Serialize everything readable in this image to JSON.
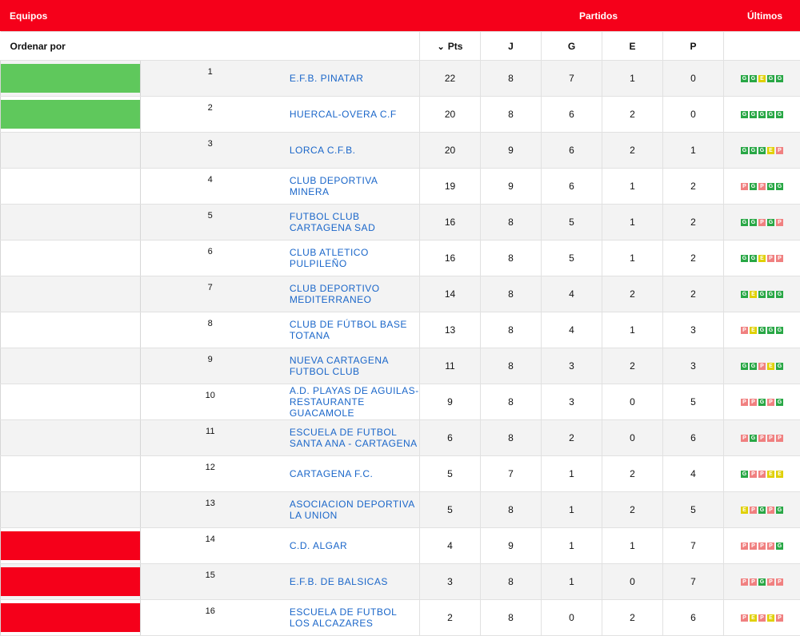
{
  "header": {
    "equipos": "Equipos",
    "partidos": "Partidos",
    "ultimos": "Últimos"
  },
  "columns": {
    "order_by": "Ordenar por",
    "pts": "Pts",
    "j": "J",
    "g": "G",
    "e": "E",
    "p": "P"
  },
  "colors": {
    "brand": "#f5001a",
    "link": "#1a66c9",
    "promo": "#5fc85c",
    "releg": "#f5001a",
    "G": "#28a745",
    "E": "#e0d000",
    "P": "#f08080"
  },
  "rows": [
    {
      "pos": "1",
      "team": "E.F.B. PINATAR",
      "pts": "22",
      "j": "8",
      "g": "7",
      "e": "1",
      "p": "0",
      "zone": "promo",
      "last": [
        "G",
        "G",
        "E",
        "G",
        "G"
      ]
    },
    {
      "pos": "2",
      "team": "HUERCAL-OVERA C.F",
      "pts": "20",
      "j": "8",
      "g": "6",
      "e": "2",
      "p": "0",
      "zone": "promo",
      "last": [
        "G",
        "G",
        "G",
        "G",
        "G"
      ]
    },
    {
      "pos": "3",
      "team": "LORCA C.F.B.",
      "pts": "20",
      "j": "9",
      "g": "6",
      "e": "2",
      "p": "1",
      "zone": "",
      "last": [
        "G",
        "G",
        "G",
        "E",
        "P"
      ]
    },
    {
      "pos": "4",
      "team": "CLUB DEPORTIVA MINERA",
      "pts": "19",
      "j": "9",
      "g": "6",
      "e": "1",
      "p": "2",
      "zone": "",
      "last": [
        "P",
        "G",
        "P",
        "G",
        "G"
      ]
    },
    {
      "pos": "5",
      "team": "FUTBOL CLUB CARTAGENA SAD",
      "pts": "16",
      "j": "8",
      "g": "5",
      "e": "1",
      "p": "2",
      "zone": "",
      "last": [
        "G",
        "G",
        "P",
        "G",
        "P"
      ]
    },
    {
      "pos": "6",
      "team": "CLUB ATLETICO PULPILEÑO",
      "pts": "16",
      "j": "8",
      "g": "5",
      "e": "1",
      "p": "2",
      "zone": "",
      "last": [
        "G",
        "G",
        "E",
        "P",
        "P"
      ]
    },
    {
      "pos": "7",
      "team": "CLUB DEPORTIVO MEDITERRANEO",
      "pts": "14",
      "j": "8",
      "g": "4",
      "e": "2",
      "p": "2",
      "zone": "",
      "last": [
        "G",
        "E",
        "G",
        "G",
        "G"
      ]
    },
    {
      "pos": "8",
      "team": "CLUB DE FÚTBOL BASE TOTANA",
      "pts": "13",
      "j": "8",
      "g": "4",
      "e": "1",
      "p": "3",
      "zone": "",
      "last": [
        "P",
        "E",
        "G",
        "G",
        "G"
      ]
    },
    {
      "pos": "9",
      "team": "NUEVA CARTAGENA FUTBOL CLUB",
      "pts": "11",
      "j": "8",
      "g": "3",
      "e": "2",
      "p": "3",
      "zone": "",
      "last": [
        "G",
        "G",
        "P",
        "E",
        "G"
      ]
    },
    {
      "pos": "10",
      "team": "A.D. PLAYAS DE AGUILAS-RESTAURANTE GUACAMOLE",
      "pts": "9",
      "j": "8",
      "g": "3",
      "e": "0",
      "p": "5",
      "zone": "",
      "last": [
        "P",
        "P",
        "G",
        "P",
        "G"
      ]
    },
    {
      "pos": "11",
      "team": "ESCUELA DE FUTBOL SANTA ANA - CARTAGENA",
      "pts": "6",
      "j": "8",
      "g": "2",
      "e": "0",
      "p": "6",
      "zone": "",
      "last": [
        "P",
        "G",
        "P",
        "P",
        "P"
      ]
    },
    {
      "pos": "12",
      "team": "CARTAGENA F.C.",
      "pts": "5",
      "j": "7",
      "g": "1",
      "e": "2",
      "p": "4",
      "zone": "",
      "last": [
        "G",
        "P",
        "P",
        "E",
        "E"
      ]
    },
    {
      "pos": "13",
      "team": "ASOCIACION DEPORTIVA LA UNION",
      "pts": "5",
      "j": "8",
      "g": "1",
      "e": "2",
      "p": "5",
      "zone": "",
      "last": [
        "E",
        "P",
        "G",
        "P",
        "G"
      ]
    },
    {
      "pos": "14",
      "team": "C.D. ALGAR",
      "pts": "4",
      "j": "9",
      "g": "1",
      "e": "1",
      "p": "7",
      "zone": "releg",
      "last": [
        "P",
        "P",
        "P",
        "P",
        "G"
      ]
    },
    {
      "pos": "15",
      "team": "E.F.B. DE BALSICAS",
      "pts": "3",
      "j": "8",
      "g": "1",
      "e": "0",
      "p": "7",
      "zone": "releg",
      "last": [
        "P",
        "P",
        "G",
        "P",
        "P"
      ]
    },
    {
      "pos": "16",
      "team": "ESCUELA DE FUTBOL LOS ALCAZARES",
      "pts": "2",
      "j": "8",
      "g": "0",
      "e": "2",
      "p": "6",
      "zone": "releg",
      "last": [
        "P",
        "E",
        "P",
        "E",
        "P"
      ]
    }
  ]
}
